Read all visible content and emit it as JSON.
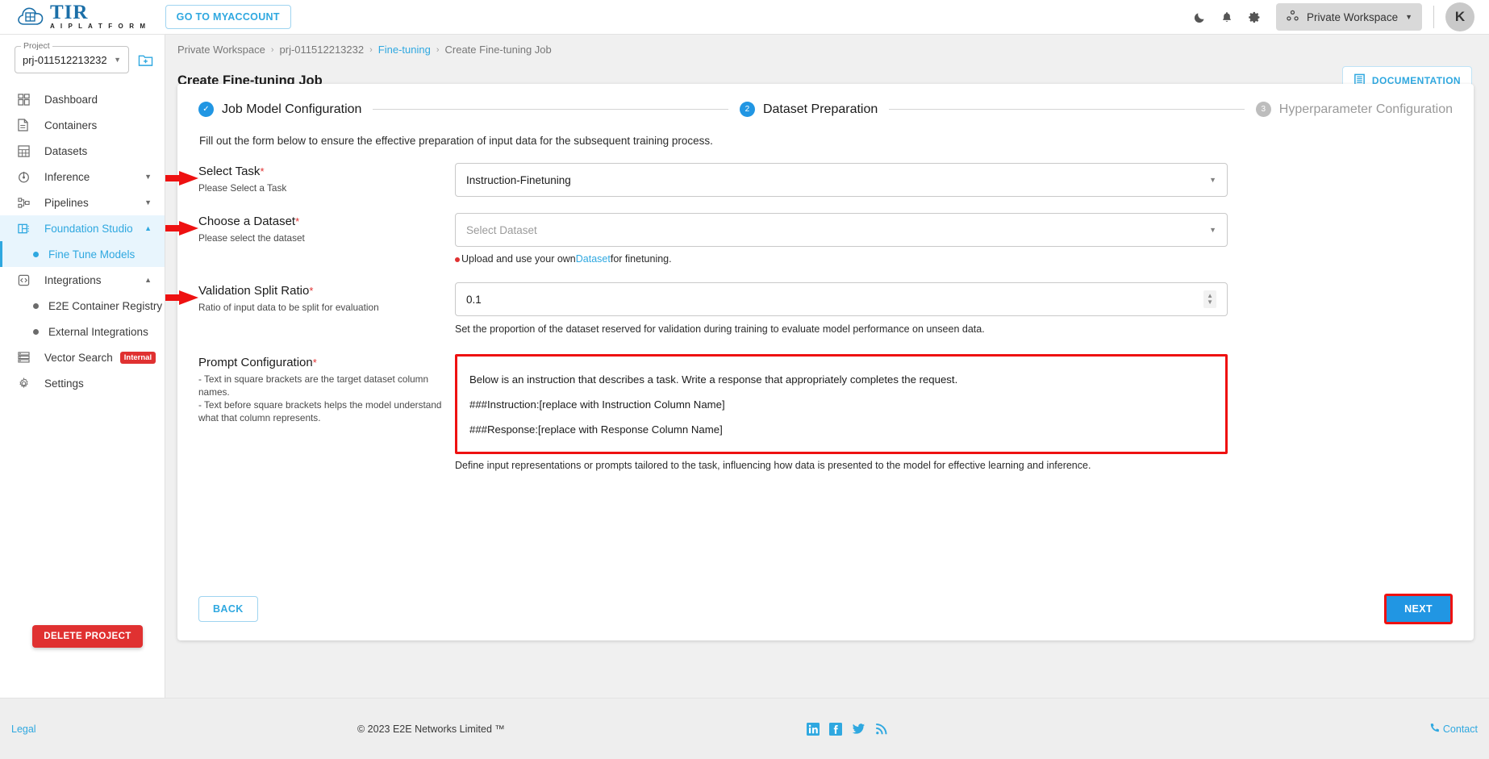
{
  "topbar": {
    "logo_title": "TIR",
    "logo_subtitle": "A I   P L A T F O R M",
    "myaccount_label": "GO TO MYACCOUNT",
    "workspace_label": "Private Workspace",
    "avatar_initial": "K",
    "icons": [
      "moon-icon",
      "bell-icon",
      "gear-icon"
    ]
  },
  "sidebar": {
    "project_legend": "Project",
    "project_value": "prj-011512213232",
    "items": [
      {
        "label": "Dashboard",
        "icon": "dashboard-icon",
        "type": "item"
      },
      {
        "label": "Containers",
        "icon": "document-icon",
        "type": "item"
      },
      {
        "label": "Datasets",
        "icon": "grid-icon",
        "type": "item"
      },
      {
        "label": "Inference",
        "icon": "inference-icon",
        "type": "expandable",
        "chevron": "down"
      },
      {
        "label": "Pipelines",
        "icon": "pipelines-icon",
        "type": "expandable",
        "chevron": "down"
      },
      {
        "label": "Foundation Studio",
        "icon": "foundation-icon",
        "type": "expandable",
        "chevron": "up",
        "active": true
      },
      {
        "label": "Fine Tune Models",
        "icon": "dot",
        "type": "sub",
        "active": true
      },
      {
        "label": "Integrations",
        "icon": "integrations-icon",
        "type": "expandable",
        "chevron": "up"
      },
      {
        "label": "E2E Container Registry",
        "icon": "dot",
        "type": "sub"
      },
      {
        "label": "External Integrations",
        "icon": "dot",
        "type": "sub"
      },
      {
        "label": "Vector Search",
        "icon": "list-icon",
        "type": "item",
        "badge": "Internal"
      },
      {
        "label": "Settings",
        "icon": "gear-icon",
        "type": "item"
      }
    ],
    "delete_project_label": "DELETE PROJECT"
  },
  "breadcrumb": [
    {
      "label": "Private Workspace",
      "link": false
    },
    {
      "label": "prj-011512213232",
      "link": false
    },
    {
      "label": "Fine-tuning",
      "link": true
    },
    {
      "label": "Create Fine-tuning Job",
      "link": false
    }
  ],
  "page": {
    "title": "Create Fine-tuning Job",
    "documentation_label": "DOCUMENTATION"
  },
  "stepper": {
    "steps": [
      {
        "marker": "✓",
        "label": "Job Model Configuration",
        "state": "done"
      },
      {
        "marker": "2",
        "label": "Dataset Preparation",
        "state": "current"
      },
      {
        "marker": "3",
        "label": "Hyperparameter Configuration",
        "state": "todo"
      }
    ]
  },
  "form": {
    "intro": "Fill out the form below to ensure the effective preparation of input data for the subsequent training process.",
    "select_task": {
      "label": "Select Task",
      "required": "*",
      "sublabel": "Please Select a Task",
      "value": "Instruction-Finetuning"
    },
    "choose_dataset": {
      "label": "Choose a Dataset",
      "required": "*",
      "sublabel": "Please select the dataset",
      "placeholder": "Select Dataset",
      "hint_before": "Upload and use your own ",
      "hint_link": "Dataset",
      "hint_after": " for finetuning."
    },
    "validation_split": {
      "label": "Validation Split Ratio",
      "required": "*",
      "sublabel": "Ratio of input data to be split for evaluation",
      "value": "0.1",
      "hint": "Set the proportion of the dataset reserved for validation during training to evaluate model performance on unseen data."
    },
    "prompt_config": {
      "label": "Prompt Configuration",
      "required": "*",
      "sublabel_line1": "- Text in square brackets are the target dataset column names.",
      "sublabel_line2": "- Text before square brackets helps the model understand what that column represents.",
      "value_line1": "Below is an instruction that describes a task. Write a response that appropriately completes the request.",
      "value_line2": "###Instruction:[replace with Instruction Column Name]",
      "value_line3": "###Response:[replace with Response Column Name]",
      "hint": "Define input representations or prompts tailored to the task, influencing how data is presented to the model for effective learning and inference."
    },
    "back_label": "BACK",
    "next_label": "NEXT"
  },
  "footer": {
    "legal": "Legal",
    "copyright": "© 2023 E2E Networks Limited ™",
    "contact": "Contact",
    "social": [
      "linkedin-icon",
      "facebook-icon",
      "twitter-icon",
      "rss-icon"
    ]
  },
  "colors": {
    "accent": "#2fa8e0",
    "primary": "#2196e3",
    "danger": "#e03131",
    "highlight": "#ee1111"
  }
}
